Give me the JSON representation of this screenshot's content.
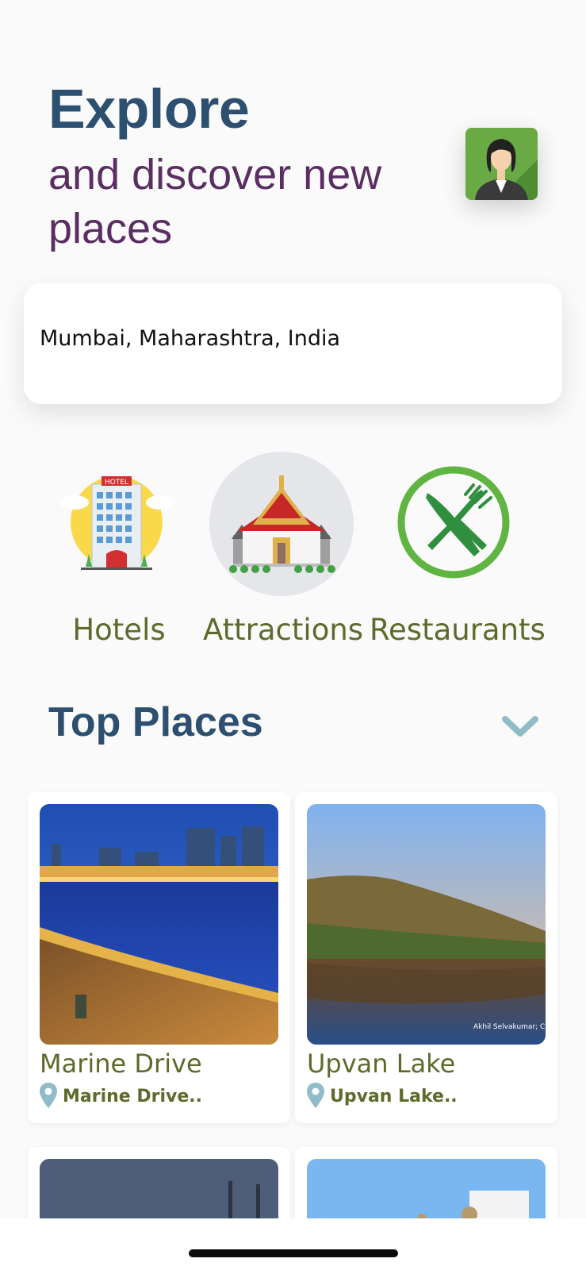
{
  "header": {
    "title": "Explore",
    "subtitle": "and discover new places"
  },
  "search": {
    "location": "Mumbai, Maharashtra, India"
  },
  "categories": [
    {
      "label": "Hotels",
      "icon": "hotel-icon"
    },
    {
      "label": "Attractions",
      "icon": "temple-icon",
      "selected": true
    },
    {
      "label": "Restaurants",
      "icon": "fork-knife-icon"
    }
  ],
  "top_places": {
    "title": "Top Places",
    "items": [
      {
        "name": "Marine Drive",
        "location": "Marine Drive.."
      },
      {
        "name": "Upvan Lake",
        "location": "Upvan Lake..",
        "photo_credit": "Akhil Selvakumar; C"
      }
    ]
  },
  "colors": {
    "title": "#2d5070",
    "subtitle": "#5a2e62",
    "label_green": "#5c6b2c",
    "pin": "#8fbcc6"
  }
}
